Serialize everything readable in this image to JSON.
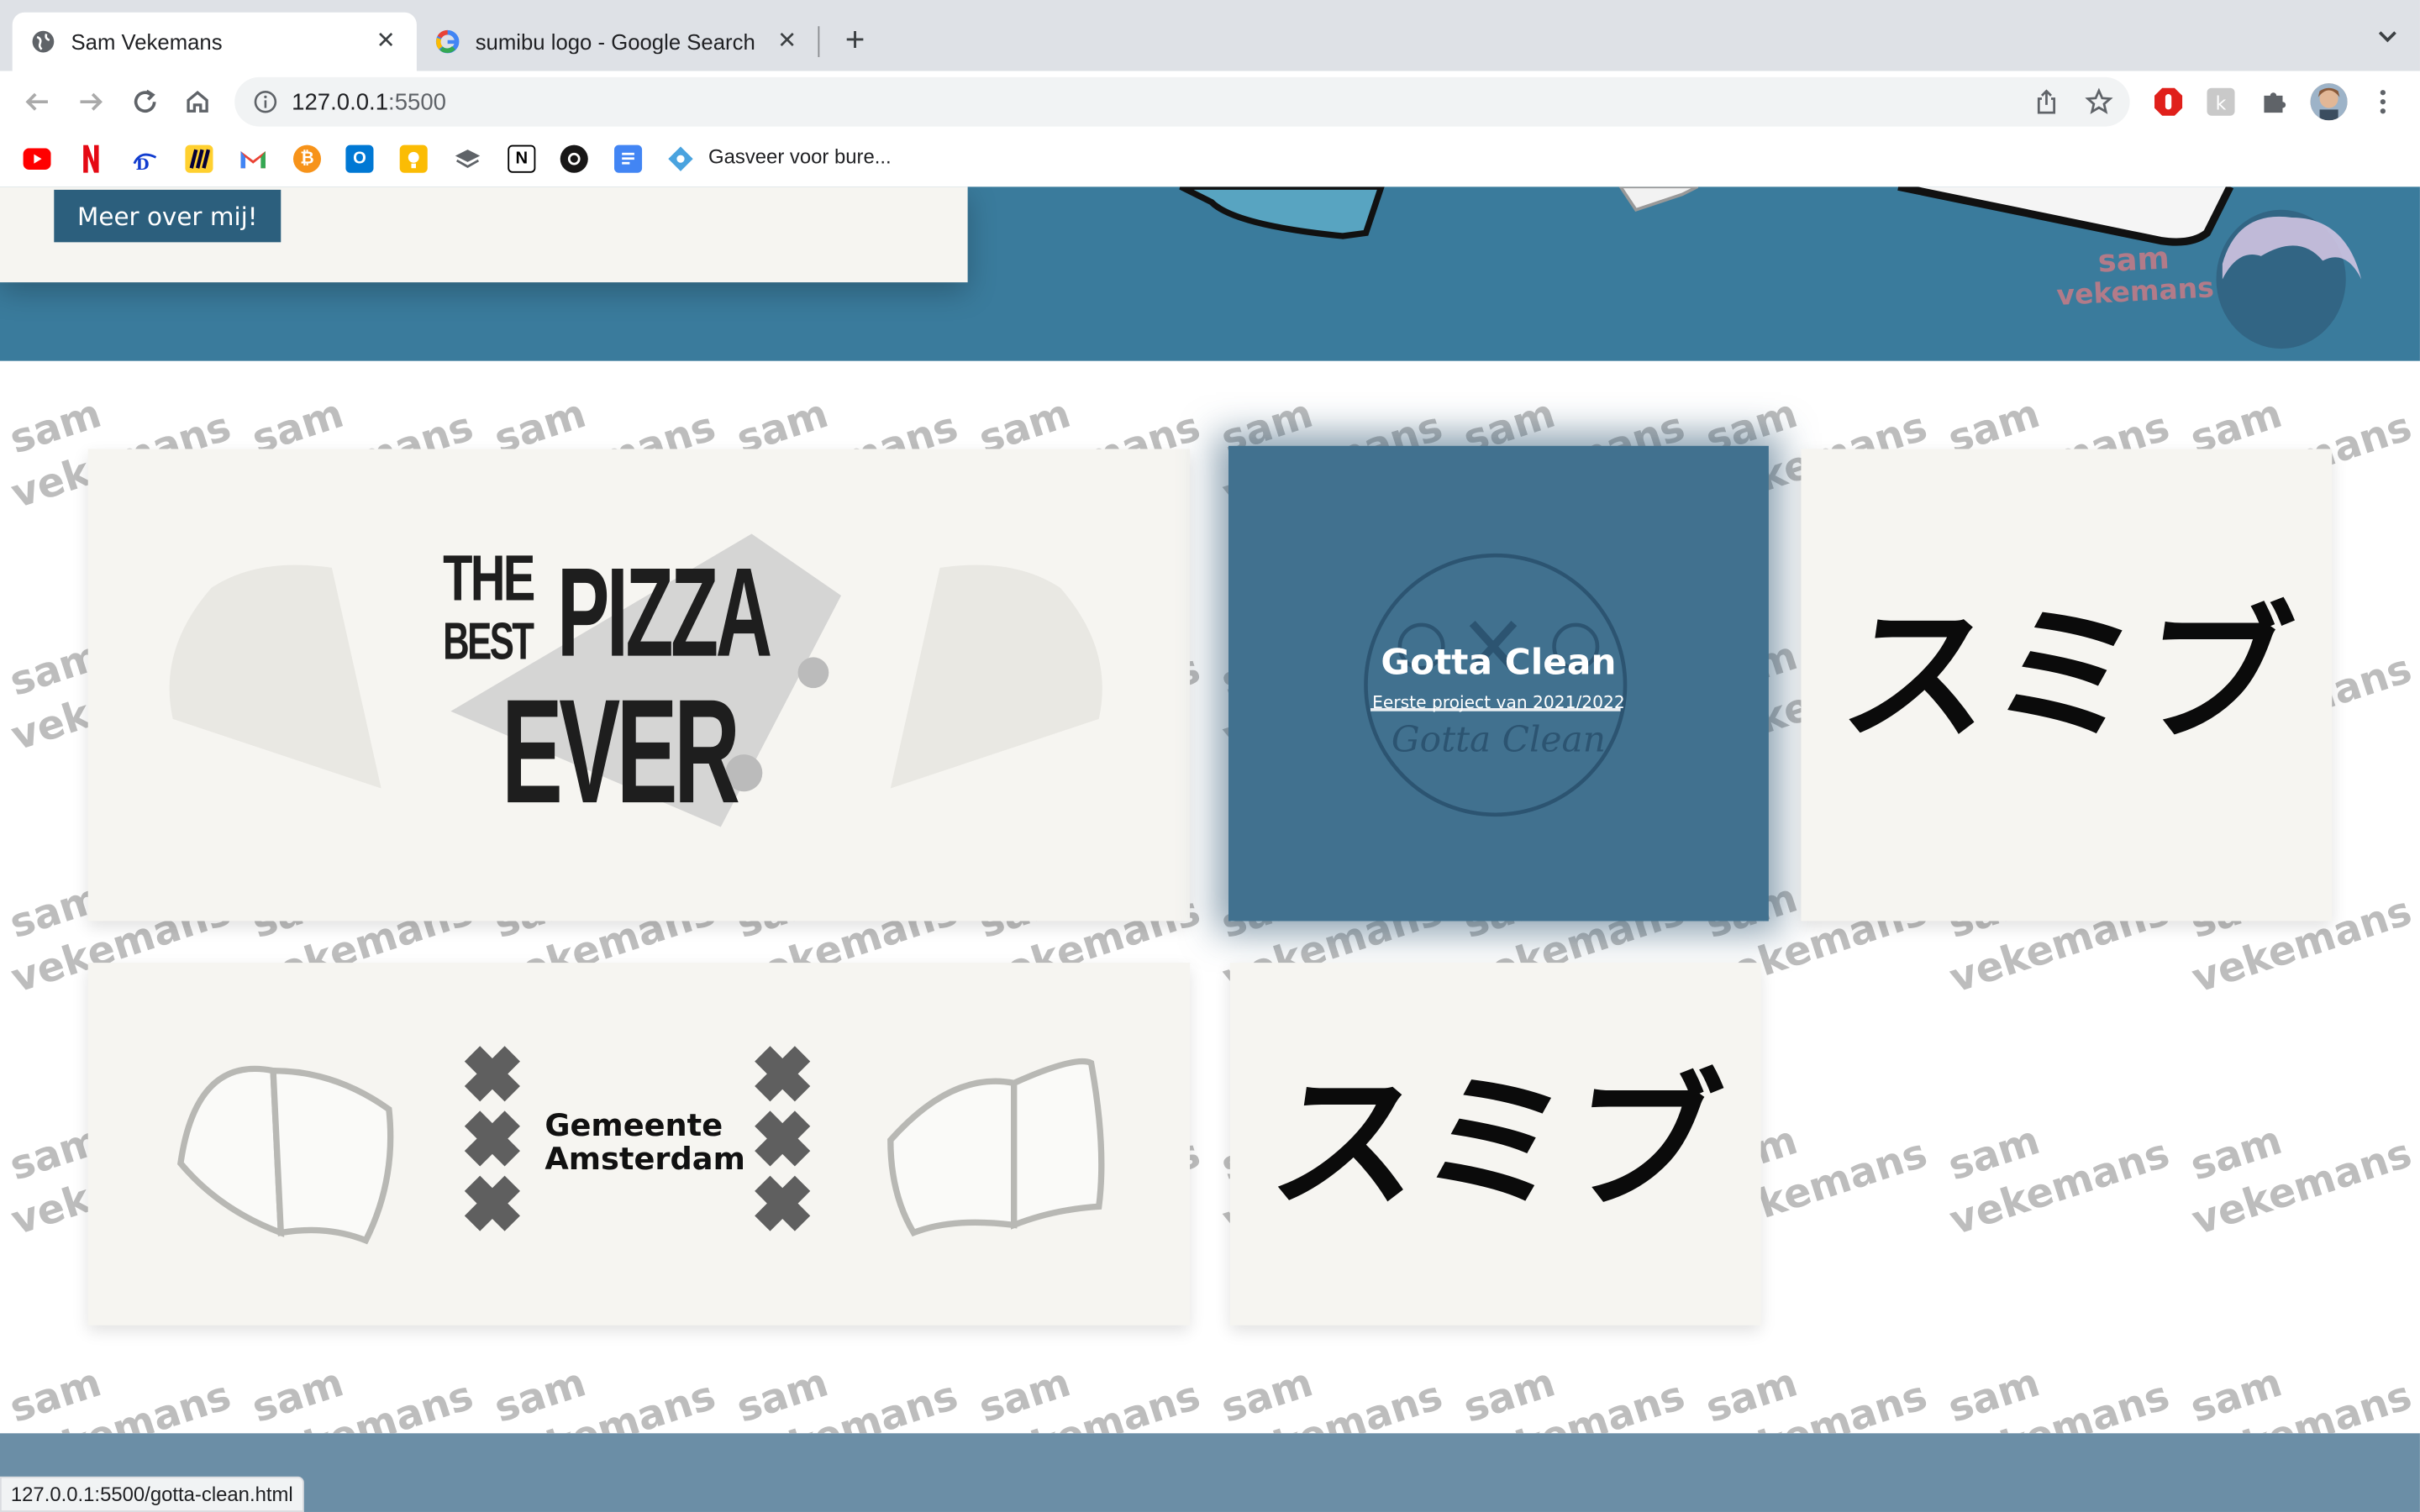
{
  "browser": {
    "tabs": [
      {
        "title": "Sam Vekemans",
        "active": true,
        "icon": "globe-icon"
      },
      {
        "title": "sumibu logo - Google Search",
        "active": false,
        "icon": "google-icon"
      }
    ],
    "url_host": "127.0.0.1",
    "url_port": ":5500",
    "bookmarks": [
      {
        "icon": "youtube-icon",
        "color": "#ff0000"
      },
      {
        "icon": "netflix-icon",
        "color": "#e50914"
      },
      {
        "icon": "disney-icon",
        "color": "#113ccf"
      },
      {
        "icon": "miro-icon",
        "color": "#050038"
      },
      {
        "icon": "gmail-icon",
        "color": "#ea4335"
      },
      {
        "icon": "bitcoin-icon",
        "color": "#f7931a"
      },
      {
        "icon": "outlook-icon",
        "color": "#0078d4"
      },
      {
        "icon": "keep-icon",
        "color": "#fbbc04"
      },
      {
        "icon": "layers-icon",
        "color": "#5f6368"
      },
      {
        "icon": "notion-icon",
        "color": "#000000"
      },
      {
        "icon": "github-icon",
        "color": "#181717"
      },
      {
        "icon": "docs-icon",
        "color": "#4285f4"
      },
      {
        "icon": "gasveer-icon",
        "color": "#4aa3df"
      }
    ],
    "bookmark_label": "Gasveer voor bure...",
    "status_url": "127.0.0.1:5500/gotta-clean.html"
  },
  "page": {
    "intro_button": "Meer over mij!",
    "hero_logo": {
      "line1": "sam",
      "line2": "vekemans"
    },
    "pattern_words": [
      "sam",
      "vekemans"
    ],
    "colors": {
      "hero": "#3a7b9c",
      "card": "#f6f5f1",
      "highlight": "#41718f",
      "button": "#2c5f7d",
      "footer": "#6b8ea6"
    },
    "projects": [
      {
        "name": "pizza",
        "lines": [
          "THE",
          "BEST",
          "PIZZA",
          "EVER"
        ]
      },
      {
        "name": "gotta-clean",
        "title": "Gotta Clean",
        "subtitle": "Eerste project van 2021/2022",
        "script": "Gotta Clean"
      },
      {
        "name": "sumibu",
        "text": "スミブ"
      },
      {
        "name": "gemeente-amsterdam",
        "line1": "Gemeente",
        "line2": "Amsterdam"
      },
      {
        "name": "sumibu-2",
        "text": "スミブ"
      }
    ]
  }
}
